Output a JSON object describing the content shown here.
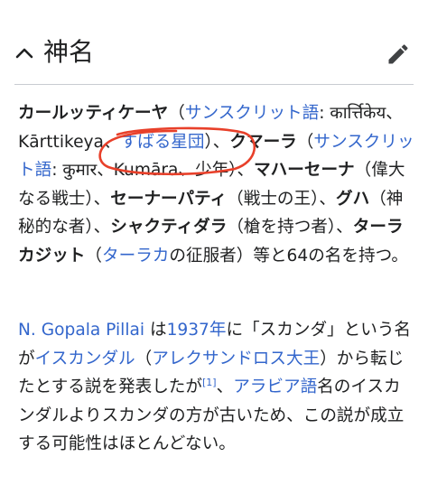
{
  "section": {
    "title": "神名",
    "chevron_icon": "chevron-up-icon",
    "edit_icon": "pencil-edit-icon"
  },
  "para1": {
    "name1": "カールッティケーヤ",
    "paren_open1": "（",
    "lang_link1": "サンスクリット語",
    "text1": ": कार्त्तिकेय、",
    "text2": "Kārttikeya、",
    "link_subaru": "すばる星団",
    "paren_close1": "）、",
    "name2": "クマーラ",
    "paren_open2": "（",
    "lang_link2": "サンスクリット語",
    "text3": ": कुमार、Kumāra、少年）、",
    "name3": "マハーセーナ",
    "text4": "（偉大なる戦士）、",
    "name4": "セーナーパティ",
    "text5": "（戦士の王）、",
    "name5": "グハ",
    "text6": "（神秘的な者）、",
    "name6": "シャクティダラ",
    "text7": "（槍を持つ者）、",
    "name7": "ターラカジット",
    "paren_open3": "（",
    "link_taraka": "ターラカ",
    "text8": "の征服者）等と64の名を持つ。"
  },
  "para2": {
    "link_author": "N. Gopala Pillai",
    "text1": " は",
    "link_year": "1937年",
    "text2": "に「スカンダ」という名が",
    "link_iskandar": "イスカンダル",
    "paren_open": "（",
    "link_alexander": "アレクサンドロス大王",
    "text3": "）から転じたとする説を発表したが",
    "citation": "[1]",
    "text4": "、",
    "link_arabic": "アラビア語",
    "text5": "名のイスカンダルよりスカンダの方が古いため、この説が成立する可能性はほとんどない。"
  },
  "colors": {
    "link": "#3366cc",
    "text": "#202122",
    "annotation": "#e8402a"
  }
}
